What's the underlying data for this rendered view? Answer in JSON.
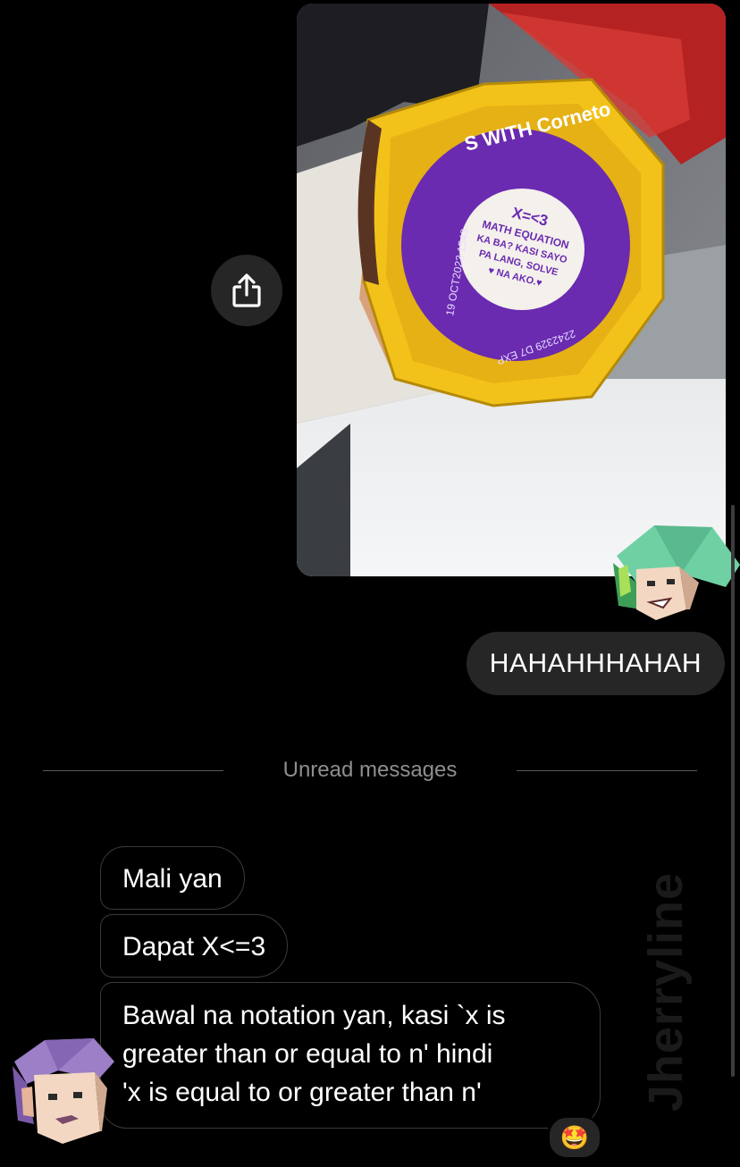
{
  "messages": {
    "outgoing_text": "HAHAHHHAHAH",
    "unread_label": "Unread messages",
    "incoming": [
      {
        "text": "Mali yan"
      },
      {
        "text": "Dapat X<=3"
      },
      {
        "lines": [
          "Bawal na notation yan, kasi `x is",
          "greater than or equal to n' hindi",
          "'x is equal to or greater than n'"
        ]
      }
    ],
    "reaction_emoji": "🤩"
  },
  "photo": {
    "lid_top_text": "S WITH Corneto",
    "lid_message_lines": [
      "X=<3",
      "MATH EQUATION",
      "KA BA? KASI SAYO",
      "PA LANG, SOLVE",
      "♥ NA AKO.♥"
    ],
    "lid_side_text": "19 OCT2023 1543",
    "lid_bottom_text": "2242329 D7 EXP"
  },
  "watermark": "Jherryline",
  "icons": {
    "share": "share-icon"
  },
  "colors": {
    "bubble_gray": "#262626",
    "lid_purple": "#6a2bb0",
    "lid_yellow": "#f2c21a"
  }
}
